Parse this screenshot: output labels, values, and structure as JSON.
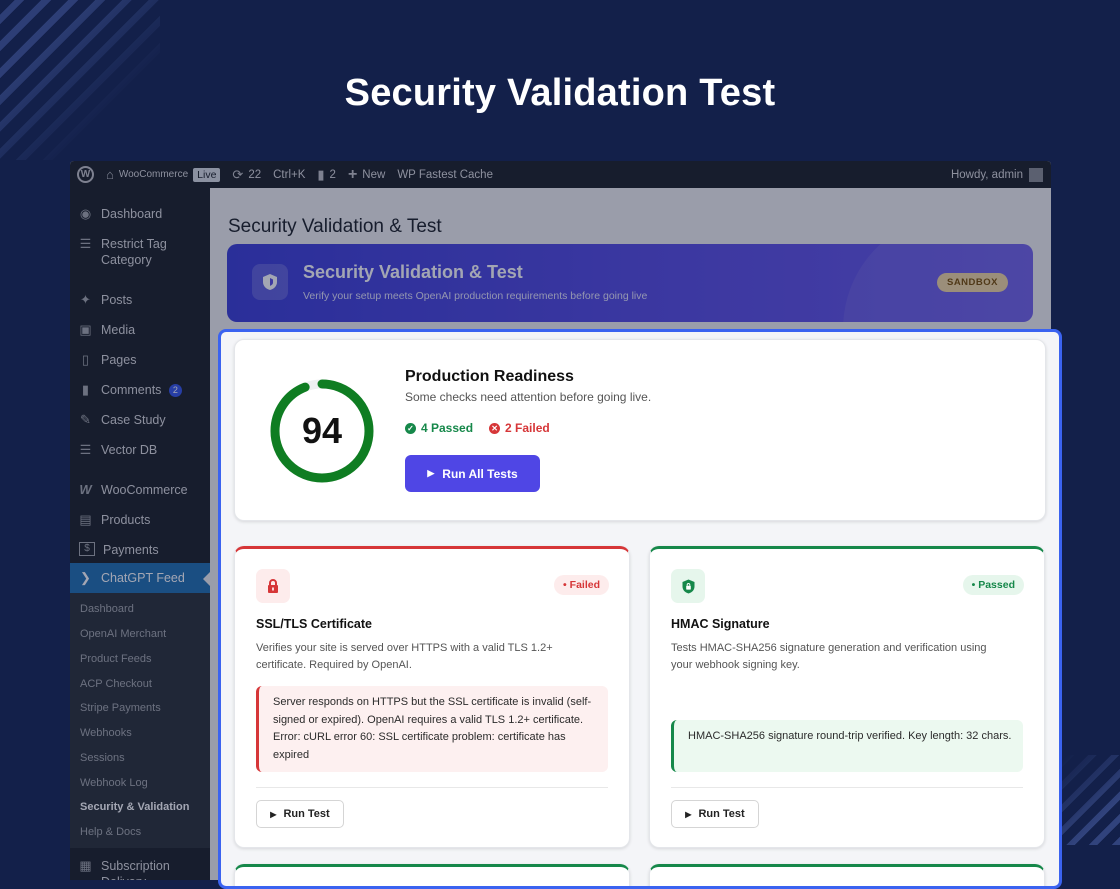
{
  "hero": {
    "title": "Security Validation Test"
  },
  "adminbar": {
    "site_name": "WooCommerce",
    "live_label": "Live",
    "updates_count": "22",
    "shortcut": "Ctrl+K",
    "comments_count": "2",
    "new_label": "New",
    "cache_label": "WP Fastest Cache",
    "howdy": "Howdy, admin"
  },
  "sidebar": {
    "items": [
      {
        "label": "Dashboard",
        "icon": "dashboard-icon"
      },
      {
        "label": "Restrict Tag Category",
        "icon": "list-icon"
      },
      {
        "label": "Posts",
        "icon": "pin-icon"
      },
      {
        "label": "Media",
        "icon": "media-icon"
      },
      {
        "label": "Pages",
        "icon": "pages-icon"
      },
      {
        "label": "Comments",
        "icon": "comment-icon",
        "badge": "2"
      },
      {
        "label": "Case Study",
        "icon": "pen-icon"
      },
      {
        "label": "Vector DB",
        "icon": "database-icon"
      },
      {
        "label": "WooCommerce",
        "icon": "woo-icon"
      },
      {
        "label": "Products",
        "icon": "archive-icon"
      },
      {
        "label": "Payments",
        "icon": "payment-icon"
      },
      {
        "label": "ChatGPT Feed",
        "icon": "rss-icon"
      }
    ],
    "submenu": [
      "Dashboard",
      "OpenAI Merchant",
      "Product Feeds",
      "ACP Checkout",
      "Stripe Payments",
      "Webhooks",
      "Sessions",
      "Webhook Log",
      "Security & Validation",
      "Help & Docs"
    ],
    "bottom_item": {
      "label": "Subscription Delivery",
      "icon": "calendar-icon"
    }
  },
  "page": {
    "heading": "Security Validation & Test",
    "banner": {
      "title": "Security Validation & Test",
      "subtitle": "Verify your setup meets OpenAI production requirements before going live",
      "badge": "SANDBOX"
    }
  },
  "readiness": {
    "score": "94",
    "score_fraction": 0.94,
    "title": "Production Readiness",
    "subtitle": "Some checks need attention before going live.",
    "passed": "4 Passed",
    "failed": "2 Failed",
    "run_all_label": "Run All Tests"
  },
  "tests": [
    {
      "title": "SSL/TLS Certificate",
      "status": "Failed",
      "icon": "lock-icon",
      "description": "Verifies your site is served over HTTPS with a valid TLS 1.2+ certificate. Required by OpenAI.",
      "message": "Server responds on HTTPS but the SSL certificate is invalid (self-signed or expired). OpenAI requires a valid TLS 1.2+ certificate. Error: cURL error 60: SSL certificate problem: certificate has expired",
      "run_label": "Run Test"
    },
    {
      "title": "HMAC Signature",
      "status": "Passed",
      "icon": "shield-lock-icon",
      "description": "Tests HMAC-SHA256 signature generation and verification using your webhook signing key.",
      "message": "HMAC-SHA256 signature round-trip verified. Key length: 32 chars.",
      "run_label": "Run Test"
    }
  ],
  "colors": {
    "accent": "#4f46e5",
    "pass": "#16884a",
    "fail": "#d63638",
    "highlight_border": "#3b63f0"
  }
}
